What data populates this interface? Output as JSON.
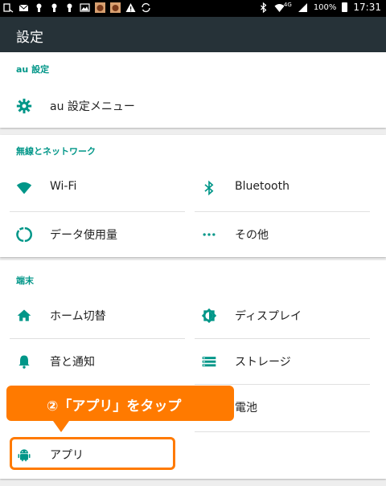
{
  "status_bar": {
    "battery_percent": "100%",
    "time": "17:31",
    "network": "4G",
    "notification_icons": [
      "screenshot-icon",
      "mail-icon",
      "keyhole-icon",
      "keyhole-icon",
      "keyhole-icon",
      "image-icon",
      "app-icon",
      "app-icon",
      "warning-icon",
      "sync-icon"
    ],
    "status_icons": [
      "bluetooth-icon",
      "wifi-icon",
      "signal-icon",
      "battery-icon"
    ]
  },
  "app_bar": {
    "title": "設定"
  },
  "sections": {
    "au": {
      "header": "au 設定",
      "items": [
        {
          "label": "au 設定メニュー",
          "icon": "gear-icon"
        }
      ]
    },
    "network": {
      "header": "無線とネットワーク",
      "items": [
        {
          "label": "Wi-Fi",
          "icon": "wifi-icon"
        },
        {
          "label": "Bluetooth",
          "icon": "bluetooth-icon"
        },
        {
          "label": "データ使用量",
          "icon": "data-usage-icon"
        },
        {
          "label": "その他",
          "icon": "more-icon"
        }
      ]
    },
    "device": {
      "header": "端末",
      "items": [
        {
          "label": "ホーム切替",
          "icon": "home-icon"
        },
        {
          "label": "ディスプレイ",
          "icon": "brightness-icon"
        },
        {
          "label": "音と通知",
          "icon": "bell-icon"
        },
        {
          "label": "ストレージ",
          "icon": "storage-icon"
        },
        {
          "label": "電池",
          "icon": "battery-icon"
        },
        {
          "label": "アプリ",
          "icon": "android-icon"
        }
      ]
    }
  },
  "callout": {
    "text": "②「アプリ」をタップ"
  },
  "colors": {
    "accent": "#009688",
    "app_bar": "#263238",
    "callout": "#ff7a00",
    "background": "#eeeeee"
  }
}
